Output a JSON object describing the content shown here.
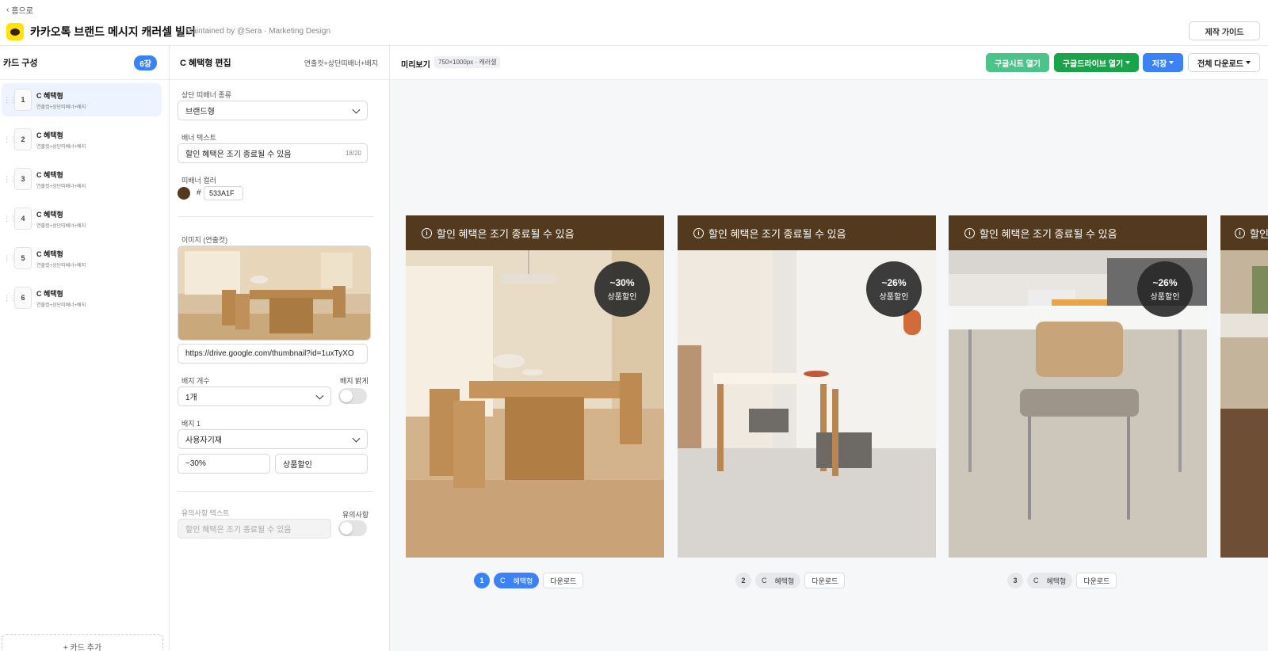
{
  "header": {
    "back_label": "홈으로",
    "title": "카카오톡 브랜드 메시지 캐러셀 빌더",
    "subtitle": "Maintained by @Sera · Marketing Design",
    "guide_button": "제작 가이드"
  },
  "sidebar": {
    "title": "카드 구성",
    "count": "6장",
    "items": [
      {
        "num": "1",
        "name": "C 혜택형",
        "desc": "연출컷+상단띠배너+배지"
      },
      {
        "num": "2",
        "name": "C 혜택형",
        "desc": "연출컷+상단띠배너+배지"
      },
      {
        "num": "3",
        "name": "C 혜택형",
        "desc": "연출컷+상단띠배너+배지"
      },
      {
        "num": "4",
        "name": "C 혜택형",
        "desc": "연출컷+상단띠배너+배지"
      },
      {
        "num": "5",
        "name": "C 혜택형",
        "desc": "연출컷+상단띠배너+배지"
      },
      {
        "num": "6",
        "name": "C 혜택형",
        "desc": "연출컷+상단띠배너+배지"
      }
    ],
    "add_label": "+ 카드 추가"
  },
  "editor": {
    "title": "C 혜택형 편집",
    "tag": "연출컷+상단띠배너+배지",
    "banner_type_label": "상단 띠배너 종류",
    "banner_type_value": "브랜드형",
    "banner_text_label": "배너 텍스트",
    "banner_text_value": "할인 혜택은 조기 종료될 수 있음",
    "banner_text_counter": "18/20",
    "banner_color_label": "띠배너 컬러",
    "banner_color_hash": "#",
    "banner_color_hex": "533A1F",
    "banner_color": "#533A1F",
    "image_label": "이미지 (연출컷)",
    "image_url": "https://drive.google.com/thumbnail?id=1uxTyXO",
    "badge_count_label": "배지 개수",
    "badge_count_value": "1개",
    "badge_bright_label": "배지 밝게",
    "badge1_label": "배지 1",
    "badge1_type": "사용자기재",
    "badge1_value": "~30%",
    "badge1_text": "상품할인",
    "notice_text_label": "유의사항 텍스트",
    "notice_text_placeholder": "할인 혜택은 조기 종료될 수 있음",
    "notice_toggle_label": "유의사항"
  },
  "preview": {
    "title": "미리보기",
    "size_tag": "750×1000px · 캐러셀",
    "btn_sheet": "구글시트 열기",
    "btn_drive": "구글드라이브 열기",
    "btn_save": "저장",
    "btn_download_all": "전체 다운로드",
    "cards": [
      {
        "banner": "할인 혜택은 조기 종료될 수 있음",
        "discount": "~30%",
        "discount_label": "상품할인",
        "num": "1",
        "type": "C",
        "type_name": "혜택형",
        "download": "다운로드"
      },
      {
        "banner": "할인 혜택은 조기 종료될 수 있음",
        "discount": "~26%",
        "discount_label": "상품할인",
        "num": "2",
        "type": "C",
        "type_name": "혜택형",
        "download": "다운로드"
      },
      {
        "banner": "할인 혜택은 조기 종료될 수 있음",
        "discount": "~26%",
        "discount_label": "상품할인",
        "num": "3",
        "type": "C",
        "type_name": "혜택형",
        "download": "다운로드"
      },
      {
        "banner": "할인"
      }
    ]
  },
  "colors": {
    "accent": "#3b82f6",
    "sheet_green": "#4cc38a",
    "drive_green": "#1aa34a",
    "banner_brown": "#533A1F",
    "kakao_yellow": "#FEE500"
  }
}
